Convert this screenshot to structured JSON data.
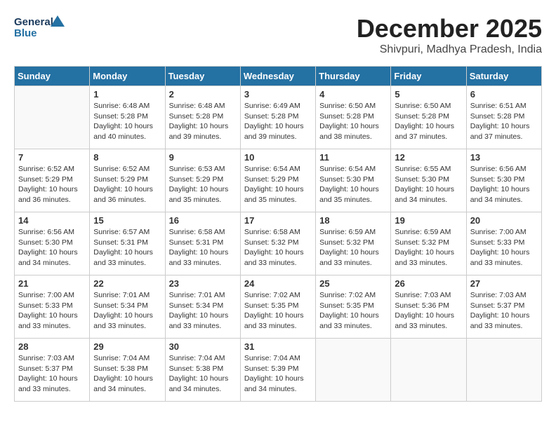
{
  "logo": {
    "line1": "General",
    "line2": "Blue"
  },
  "title": {
    "month_year": "December 2025",
    "location": "Shivpuri, Madhya Pradesh, India"
  },
  "headers": [
    "Sunday",
    "Monday",
    "Tuesday",
    "Wednesday",
    "Thursday",
    "Friday",
    "Saturday"
  ],
  "weeks": [
    [
      {
        "day": "",
        "info": ""
      },
      {
        "day": "1",
        "info": "Sunrise: 6:48 AM\nSunset: 5:28 PM\nDaylight: 10 hours\nand 40 minutes."
      },
      {
        "day": "2",
        "info": "Sunrise: 6:48 AM\nSunset: 5:28 PM\nDaylight: 10 hours\nand 39 minutes."
      },
      {
        "day": "3",
        "info": "Sunrise: 6:49 AM\nSunset: 5:28 PM\nDaylight: 10 hours\nand 39 minutes."
      },
      {
        "day": "4",
        "info": "Sunrise: 6:50 AM\nSunset: 5:28 PM\nDaylight: 10 hours\nand 38 minutes."
      },
      {
        "day": "5",
        "info": "Sunrise: 6:50 AM\nSunset: 5:28 PM\nDaylight: 10 hours\nand 37 minutes."
      },
      {
        "day": "6",
        "info": "Sunrise: 6:51 AM\nSunset: 5:28 PM\nDaylight: 10 hours\nand 37 minutes."
      }
    ],
    [
      {
        "day": "7",
        "info": "Sunrise: 6:52 AM\nSunset: 5:29 PM\nDaylight: 10 hours\nand 36 minutes."
      },
      {
        "day": "8",
        "info": "Sunrise: 6:52 AM\nSunset: 5:29 PM\nDaylight: 10 hours\nand 36 minutes."
      },
      {
        "day": "9",
        "info": "Sunrise: 6:53 AM\nSunset: 5:29 PM\nDaylight: 10 hours\nand 35 minutes."
      },
      {
        "day": "10",
        "info": "Sunrise: 6:54 AM\nSunset: 5:29 PM\nDaylight: 10 hours\nand 35 minutes."
      },
      {
        "day": "11",
        "info": "Sunrise: 6:54 AM\nSunset: 5:30 PM\nDaylight: 10 hours\nand 35 minutes."
      },
      {
        "day": "12",
        "info": "Sunrise: 6:55 AM\nSunset: 5:30 PM\nDaylight: 10 hours\nand 34 minutes."
      },
      {
        "day": "13",
        "info": "Sunrise: 6:56 AM\nSunset: 5:30 PM\nDaylight: 10 hours\nand 34 minutes."
      }
    ],
    [
      {
        "day": "14",
        "info": "Sunrise: 6:56 AM\nSunset: 5:30 PM\nDaylight: 10 hours\nand 34 minutes."
      },
      {
        "day": "15",
        "info": "Sunrise: 6:57 AM\nSunset: 5:31 PM\nDaylight: 10 hours\nand 33 minutes."
      },
      {
        "day": "16",
        "info": "Sunrise: 6:58 AM\nSunset: 5:31 PM\nDaylight: 10 hours\nand 33 minutes."
      },
      {
        "day": "17",
        "info": "Sunrise: 6:58 AM\nSunset: 5:32 PM\nDaylight: 10 hours\nand 33 minutes."
      },
      {
        "day": "18",
        "info": "Sunrise: 6:59 AM\nSunset: 5:32 PM\nDaylight: 10 hours\nand 33 minutes."
      },
      {
        "day": "19",
        "info": "Sunrise: 6:59 AM\nSunset: 5:32 PM\nDaylight: 10 hours\nand 33 minutes."
      },
      {
        "day": "20",
        "info": "Sunrise: 7:00 AM\nSunset: 5:33 PM\nDaylight: 10 hours\nand 33 minutes."
      }
    ],
    [
      {
        "day": "21",
        "info": "Sunrise: 7:00 AM\nSunset: 5:33 PM\nDaylight: 10 hours\nand 33 minutes."
      },
      {
        "day": "22",
        "info": "Sunrise: 7:01 AM\nSunset: 5:34 PM\nDaylight: 10 hours\nand 33 minutes."
      },
      {
        "day": "23",
        "info": "Sunrise: 7:01 AM\nSunset: 5:34 PM\nDaylight: 10 hours\nand 33 minutes."
      },
      {
        "day": "24",
        "info": "Sunrise: 7:02 AM\nSunset: 5:35 PM\nDaylight: 10 hours\nand 33 minutes."
      },
      {
        "day": "25",
        "info": "Sunrise: 7:02 AM\nSunset: 5:35 PM\nDaylight: 10 hours\nand 33 minutes."
      },
      {
        "day": "26",
        "info": "Sunrise: 7:03 AM\nSunset: 5:36 PM\nDaylight: 10 hours\nand 33 minutes."
      },
      {
        "day": "27",
        "info": "Sunrise: 7:03 AM\nSunset: 5:37 PM\nDaylight: 10 hours\nand 33 minutes."
      }
    ],
    [
      {
        "day": "28",
        "info": "Sunrise: 7:03 AM\nSunset: 5:37 PM\nDaylight: 10 hours\nand 33 minutes."
      },
      {
        "day": "29",
        "info": "Sunrise: 7:04 AM\nSunset: 5:38 PM\nDaylight: 10 hours\nand 34 minutes."
      },
      {
        "day": "30",
        "info": "Sunrise: 7:04 AM\nSunset: 5:38 PM\nDaylight: 10 hours\nand 34 minutes."
      },
      {
        "day": "31",
        "info": "Sunrise: 7:04 AM\nSunset: 5:39 PM\nDaylight: 10 hours\nand 34 minutes."
      },
      {
        "day": "",
        "info": ""
      },
      {
        "day": "",
        "info": ""
      },
      {
        "day": "",
        "info": ""
      }
    ]
  ]
}
